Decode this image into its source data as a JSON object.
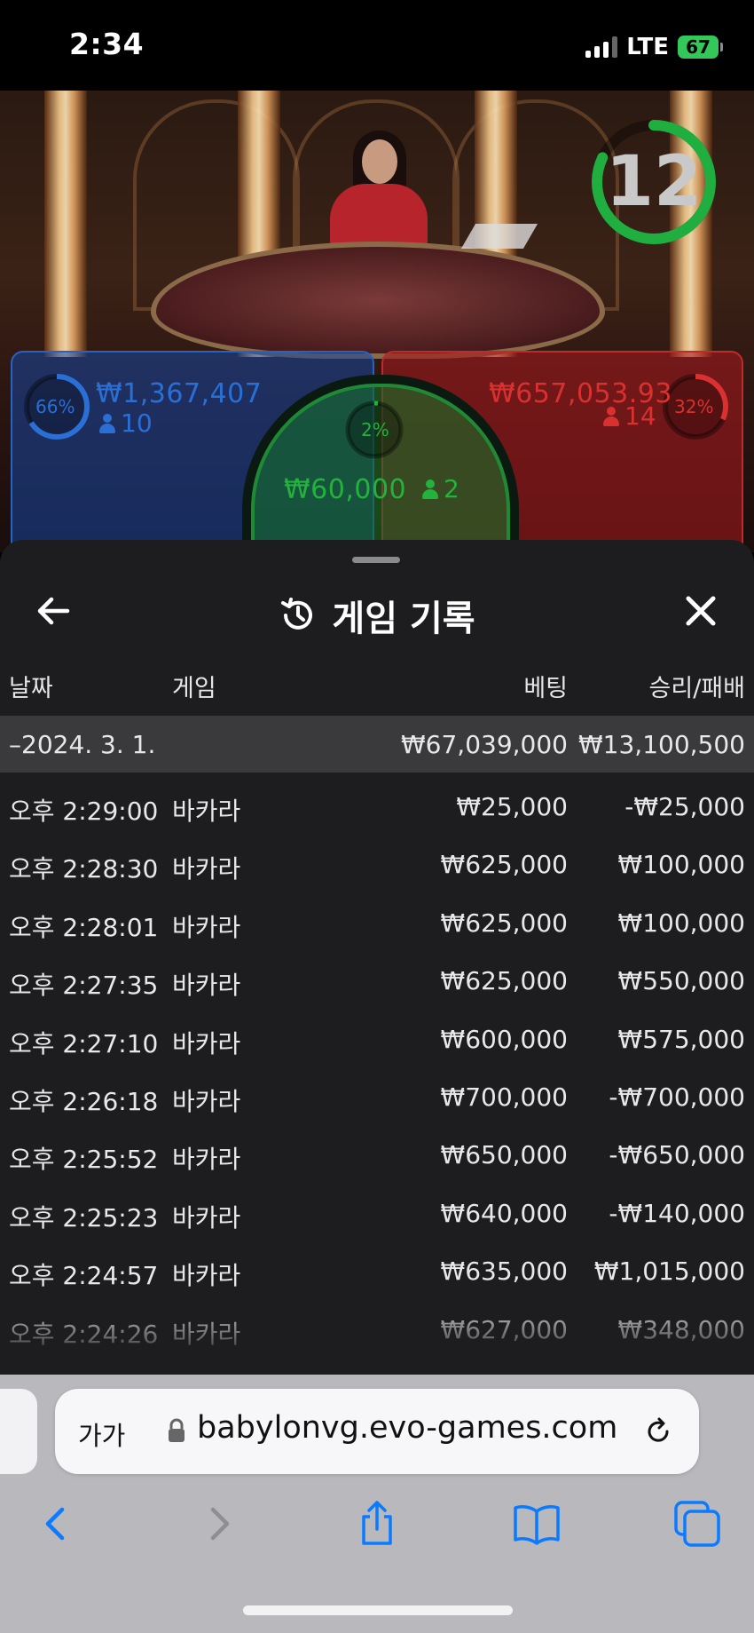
{
  "status_bar": {
    "time": "2:34",
    "network": "LTE",
    "battery": "67"
  },
  "game": {
    "timer": "12",
    "player": {
      "percent": "66%",
      "amount": "₩1,367,407",
      "players": "10",
      "color": "#2a6fd6"
    },
    "banker": {
      "percent": "32%",
      "amount": "₩657,053.93",
      "players": "14",
      "color": "#d93030"
    },
    "tie": {
      "percent": "2%",
      "amount": "₩60,000",
      "players": "2",
      "color": "#23b23c"
    }
  },
  "sheet": {
    "title": "게임 기록",
    "title_icon": "history-icon",
    "back_icon": "arrow-left-icon",
    "close_icon": "close-icon",
    "columns": [
      "날짜",
      "게임",
      "베팅",
      "승리/패배"
    ],
    "date_row": {
      "date": "–2024. 3. 1.",
      "bet": "₩67,039,000",
      "result": "₩13,100,500"
    },
    "rows": [
      {
        "time": "오후 2:29:00",
        "game": "바카라",
        "bet": "₩25,000",
        "result": "-₩25,000"
      },
      {
        "time": "오후 2:28:30",
        "game": "바카라",
        "bet": "₩625,000",
        "result": "₩100,000"
      },
      {
        "time": "오후 2:28:01",
        "game": "바카라",
        "bet": "₩625,000",
        "result": "₩100,000"
      },
      {
        "time": "오후 2:27:35",
        "game": "바카라",
        "bet": "₩625,000",
        "result": "₩550,000"
      },
      {
        "time": "오후 2:27:10",
        "game": "바카라",
        "bet": "₩600,000",
        "result": "₩575,000"
      },
      {
        "time": "오후 2:26:18",
        "game": "바카라",
        "bet": "₩700,000",
        "result": "-₩700,000"
      },
      {
        "time": "오후 2:25:52",
        "game": "바카라",
        "bet": "₩650,000",
        "result": "-₩650,000"
      },
      {
        "time": "오후 2:25:23",
        "game": "바카라",
        "bet": "₩640,000",
        "result": "-₩140,000"
      },
      {
        "time": "오후 2:24:57",
        "game": "바카라",
        "bet": "₩635,000",
        "result": "₩1,015,000"
      },
      {
        "time": "오후 2:24:26",
        "game": "바카라",
        "bet": "₩627,000",
        "result": "₩348,000"
      }
    ]
  },
  "browser": {
    "text_size_label": "가가",
    "url": "babylonvg.evo-games.com",
    "toolbar_icons": [
      "back-icon",
      "forward-icon",
      "share-icon",
      "bookmarks-icon",
      "tabs-icon"
    ],
    "accent": "#0a7aff"
  }
}
